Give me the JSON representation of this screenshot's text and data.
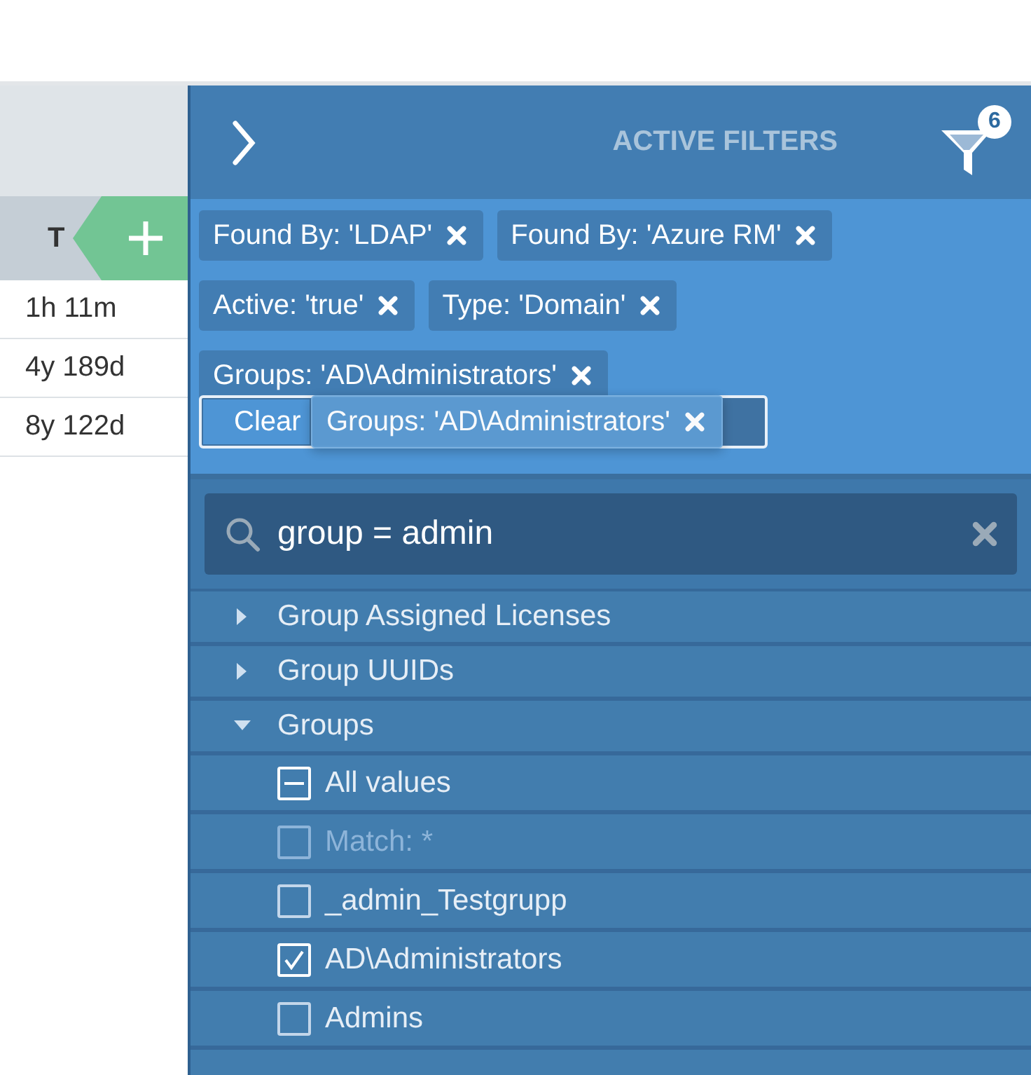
{
  "table": {
    "columns": [
      {
        "label": "T"
      }
    ],
    "rows": [
      {
        "cells": [
          "1h 11m"
        ]
      },
      {
        "cells": [
          "4y 189d"
        ]
      },
      {
        "cells": [
          "8y 122d"
        ]
      }
    ]
  },
  "panel": {
    "title": "ACTIVE FILTERS",
    "filter_count": "6",
    "chips": [
      {
        "label": "Found By: 'LDAP'"
      },
      {
        "label": "Found By: 'Azure RM'"
      },
      {
        "label": "Active: 'true'"
      },
      {
        "label": "Type: 'Domain'"
      },
      {
        "label": "Groups: 'AD\\Administrators'"
      }
    ],
    "clear_button": "Clear",
    "dragged_chip": "Groups: 'AD\\Administrators'",
    "search": {
      "value": "group = admin"
    },
    "tree": [
      {
        "label": "Group Assigned Licenses",
        "expanded": false
      },
      {
        "label": "Group UUIDs",
        "expanded": false
      },
      {
        "label": "Groups",
        "expanded": true,
        "children": [
          {
            "label": "All values",
            "checked": false,
            "mixed": true,
            "disabled": false
          },
          {
            "label": "Match: *",
            "checked": false,
            "mixed": false,
            "disabled": true
          },
          {
            "label": "_admin_Testgrupp",
            "checked": false,
            "mixed": false,
            "disabled": false
          },
          {
            "label": "AD\\Administrators",
            "checked": true,
            "mixed": false,
            "disabled": false
          },
          {
            "label": "Admins",
            "checked": false,
            "mixed": false,
            "disabled": false
          }
        ]
      }
    ]
  }
}
